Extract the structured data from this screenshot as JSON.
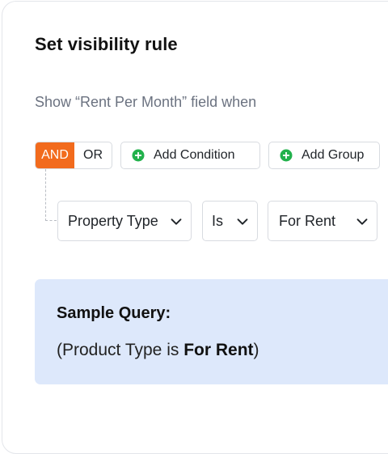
{
  "dialog": {
    "title": "Set visibility rule",
    "subtitle": "Show “Rent Per Month” field when"
  },
  "toolbar": {
    "logic_and": "AND",
    "logic_or": "OR",
    "logic_selected": "AND",
    "add_condition_label": "Add Condition",
    "add_group_label": "Add Group"
  },
  "condition": {
    "field": "Property Type",
    "operator": "Is",
    "value": "For Rent"
  },
  "query": {
    "title": "Sample Query:",
    "open_paren": "(",
    "prefix": "Product Type is ",
    "value": "For Rent",
    "close_paren": ")"
  },
  "colors": {
    "accent_orange": "#f26b1d",
    "add_icon_green": "#22b14c",
    "query_bg": "#dde8fb"
  },
  "icons": {
    "add": "plus-circle-icon",
    "dropdown": "chevron-down-icon"
  }
}
